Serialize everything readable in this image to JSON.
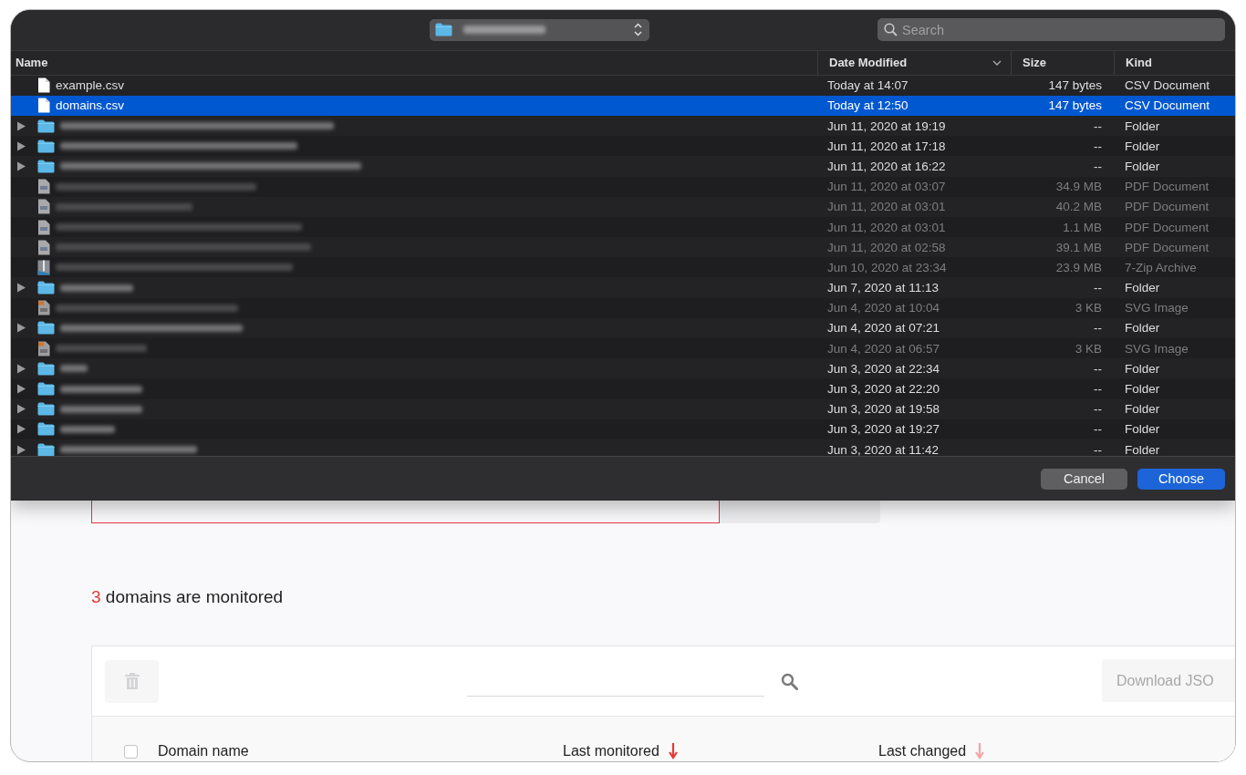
{
  "dialog": {
    "location_popup": {
      "kind": "folder"
    },
    "search": {
      "placeholder": "Search"
    },
    "columns": [
      {
        "label": "Name",
        "sorted": false
      },
      {
        "label": "Date Modified",
        "sorted": true
      },
      {
        "label": "Size",
        "sorted": false
      },
      {
        "label": "Kind",
        "sorted": false
      }
    ],
    "rows": [
      {
        "kind": "csv",
        "name": "example.csv",
        "date": "Today at 14:07",
        "size": "147 bytes",
        "type": "CSV Document",
        "selected": false,
        "disabled": false
      },
      {
        "kind": "csv",
        "name": "domains.csv",
        "date": "Today at 12:50",
        "size": "147 bytes",
        "type": "CSV Document",
        "selected": true,
        "disabled": false
      },
      {
        "kind": "folder",
        "date": "Jun 11, 2020 at 19:19",
        "size": "--",
        "type": "Folder",
        "selected": false,
        "disabled": false
      },
      {
        "kind": "folder",
        "date": "Jun 11, 2020 at 17:18",
        "size": "--",
        "type": "Folder",
        "selected": false,
        "disabled": false
      },
      {
        "kind": "folder",
        "date": "Jun 11, 2020 at 16:22",
        "size": "--",
        "type": "Folder",
        "selected": false,
        "disabled": false
      },
      {
        "kind": "pdf",
        "date": "Jun 11, 2020 at 03:07",
        "size": "34.9 MB",
        "type": "PDF Document",
        "selected": false,
        "disabled": true
      },
      {
        "kind": "pdf",
        "date": "Jun 11, 2020 at 03:01",
        "size": "40.2 MB",
        "type": "PDF Document",
        "selected": false,
        "disabled": true
      },
      {
        "kind": "pdf",
        "date": "Jun 11, 2020 at 03:01",
        "size": "1.1 MB",
        "type": "PDF Document",
        "selected": false,
        "disabled": true
      },
      {
        "kind": "pdf",
        "date": "Jun 11, 2020 at 02:58",
        "size": "39.1 MB",
        "type": "PDF Document",
        "selected": false,
        "disabled": true
      },
      {
        "kind": "zip",
        "date": "Jun 10, 2020 at 23:34",
        "size": "23.9 MB",
        "type": "7-Zip Archive",
        "selected": false,
        "disabled": true
      },
      {
        "kind": "folder",
        "date": "Jun 7, 2020 at 11:13",
        "size": "--",
        "type": "Folder",
        "selected": false,
        "disabled": false
      },
      {
        "kind": "svg",
        "date": "Jun 4, 2020 at 10:04",
        "size": "3 KB",
        "type": "SVG Image",
        "selected": false,
        "disabled": true
      },
      {
        "kind": "folder",
        "date": "Jun 4, 2020 at 07:21",
        "size": "--",
        "type": "Folder",
        "selected": false,
        "disabled": false
      },
      {
        "kind": "svg",
        "date": "Jun 4, 2020 at 06:57",
        "size": "3 KB",
        "type": "SVG Image",
        "selected": false,
        "disabled": true
      },
      {
        "kind": "folder",
        "date": "Jun 3, 2020 at 22:34",
        "size": "--",
        "type": "Folder",
        "selected": false,
        "disabled": false
      },
      {
        "kind": "folder",
        "date": "Jun 3, 2020 at 22:20",
        "size": "--",
        "type": "Folder",
        "selected": false,
        "disabled": false
      },
      {
        "kind": "folder",
        "date": "Jun 3, 2020 at 19:58",
        "size": "--",
        "type": "Folder",
        "selected": false,
        "disabled": false
      },
      {
        "kind": "folder",
        "date": "Jun 3, 2020 at 19:27",
        "size": "--",
        "type": "Folder",
        "selected": false,
        "disabled": false
      },
      {
        "kind": "folder",
        "date": "Jun 3, 2020 at 11:42",
        "size": "--",
        "type": "Folder",
        "selected": false,
        "disabled": false
      }
    ],
    "buttons": [
      {
        "label": "Cancel",
        "kind": "secondary"
      },
      {
        "label": "Choose",
        "kind": "primary"
      }
    ]
  },
  "page": {
    "summary": {
      "count": "3",
      "text": "domains are monitored"
    },
    "table": {
      "delete_disabled": true,
      "download_button": {
        "label": "Download JSO",
        "disabled": true
      },
      "select_all": {
        "checked": false
      },
      "columns": [
        {
          "label": "Domain name",
          "sortable": false
        },
        {
          "label": "Last monitored",
          "sortable": true,
          "sorted": true
        },
        {
          "label": "Last changed",
          "sortable": true,
          "sorted": false
        }
      ]
    }
  }
}
